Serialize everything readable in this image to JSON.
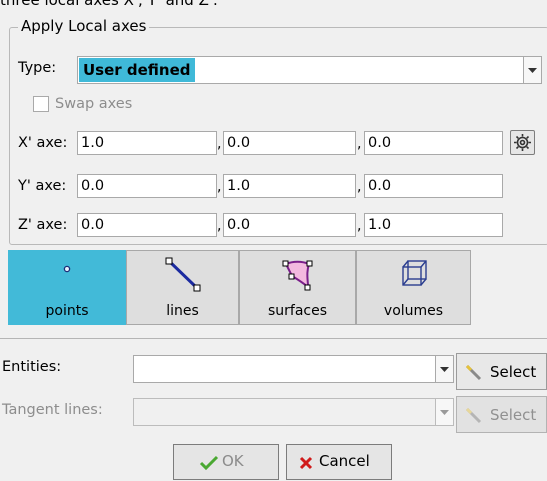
{
  "top_fragment": "three local axes X', Y' and Z'.",
  "group": {
    "title": "Apply Local axes"
  },
  "type_row": {
    "label": "Type:",
    "value": "User defined"
  },
  "swap": {
    "label": "Swap axes",
    "checked": false
  },
  "axes": [
    {
      "label": "X' axe:",
      "values": [
        "1.0",
        "0.0",
        "0.0"
      ]
    },
    {
      "label": "Y' axe:",
      "values": [
        "0.0",
        "1.0",
        "0.0"
      ]
    },
    {
      "label": "Z' axe:",
      "values": [
        "0.0",
        "0.0",
        "1.0"
      ]
    }
  ],
  "tabs": [
    {
      "label": "points",
      "active": true
    },
    {
      "label": "lines",
      "active": false
    },
    {
      "label": "surfaces",
      "active": false
    },
    {
      "label": "volumes",
      "active": false
    }
  ],
  "entities": {
    "label": "Entities:",
    "value": "",
    "select_label": "Select"
  },
  "tangent": {
    "label": "Tangent lines:",
    "value": "",
    "select_label": "Select"
  },
  "footer": {
    "ok_label": "OK",
    "cancel_label": "Cancel"
  },
  "colors": {
    "accent": "#42bad8",
    "selection": "#3fb9d8",
    "ok_check": "#4aa832",
    "cancel_x": "#d01b1b"
  }
}
